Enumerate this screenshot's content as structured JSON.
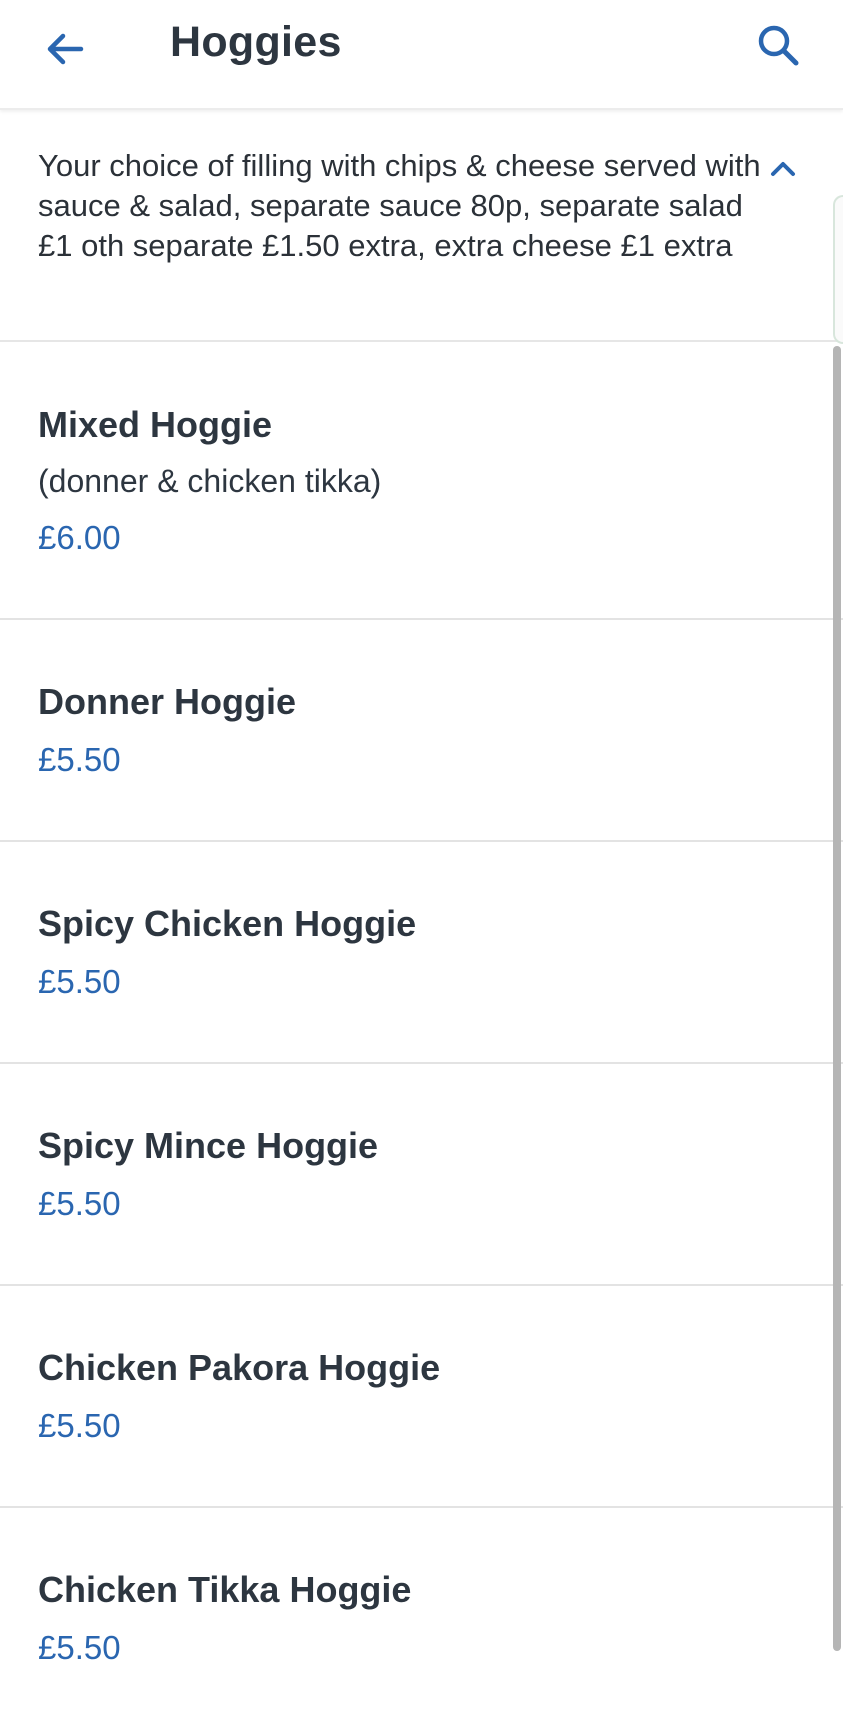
{
  "header": {
    "title": "Hoggies",
    "back_icon": "arrow-left-icon",
    "search_icon": "search-icon"
  },
  "category": {
    "description": "Your choice of filling with chips & cheese served with sauce & salad, separate sauce 80p, separate salad £1 oth separate £1.50 extra, extra cheese £1 extra",
    "expanded": true,
    "toggle_icon": "chevron-up-icon"
  },
  "items": [
    {
      "name": "Mixed Hoggie",
      "description": "(donner & chicken tikka)",
      "price": "£6.00"
    },
    {
      "name": "Donner Hoggie",
      "price": "£5.50"
    },
    {
      "name": "Spicy Chicken Hoggie",
      "price": "£5.50"
    },
    {
      "name": "Spicy Mince Hoggie",
      "price": "£5.50"
    },
    {
      "name": "Chicken Pakora Hoggie",
      "price": "£5.50"
    },
    {
      "name": "Chicken Tikka Hoggie",
      "price": "£5.50"
    }
  ],
  "colors": {
    "accent": "#2a66b0",
    "text": "#2d3640",
    "divider": "#e3e3e3",
    "scrollbar": "#b5b5b5"
  }
}
